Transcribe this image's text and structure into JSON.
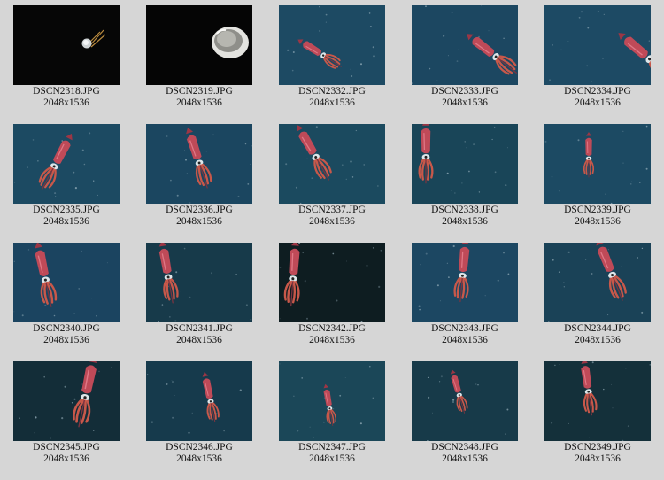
{
  "thumbnails": [
    {
      "filename": "DSCN2318.JPG",
      "dims": "2048x1536",
      "bg": "#060606",
      "subject": "probe"
    },
    {
      "filename": "DSCN2319.JPG",
      "dims": "2048x1536",
      "bg": "#050505",
      "subject": "jelly"
    },
    {
      "filename": "DSCN2332.JPG",
      "dims": "2048x1536",
      "bg": "#1d4a63",
      "subject": "squid"
    },
    {
      "filename": "DSCN2333.JPG",
      "dims": "2048x1536",
      "bg": "#1c4761",
      "subject": "squid"
    },
    {
      "filename": "DSCN2334.JPG",
      "dims": "2048x1536",
      "bg": "#1d4a64",
      "subject": "squid"
    },
    {
      "filename": "DSCN2335.JPG",
      "dims": "2048x1536",
      "bg": "#1c4a62",
      "subject": "squid"
    },
    {
      "filename": "DSCN2336.JPG",
      "dims": "2048x1536",
      "bg": "#1b4660",
      "subject": "squid"
    },
    {
      "filename": "DSCN2337.JPG",
      "dims": "2048x1536",
      "bg": "#1b4a5f",
      "subject": "squid"
    },
    {
      "filename": "DSCN2338.JPG",
      "dims": "2048x1536",
      "bg": "#194558",
      "subject": "squid"
    },
    {
      "filename": "DSCN2339.JPG",
      "dims": "2048x1536",
      "bg": "#1c4a63",
      "subject": "squid"
    },
    {
      "filename": "DSCN2340.JPG",
      "dims": "2048x1536",
      "bg": "#1b4460",
      "subject": "squid"
    },
    {
      "filename": "DSCN2341.JPG",
      "dims": "2048x1536",
      "bg": "#173a4a",
      "subject": "squid"
    },
    {
      "filename": "DSCN2342.JPG",
      "dims": "2048x1536",
      "bg": "#0e1d21",
      "subject": "squid"
    },
    {
      "filename": "DSCN2343.JPG",
      "dims": "2048x1536",
      "bg": "#1c4762",
      "subject": "squid"
    },
    {
      "filename": "DSCN2344.JPG",
      "dims": "2048x1536",
      "bg": "#1a4257",
      "subject": "squid"
    },
    {
      "filename": "DSCN2345.JPG",
      "dims": "2048x1536",
      "bg": "#132d38",
      "subject": "squid"
    },
    {
      "filename": "DSCN2346.JPG",
      "dims": "2048x1536",
      "bg": "#163a4c",
      "subject": "squid"
    },
    {
      "filename": "DSCN2347.JPG",
      "dims": "2048x1536",
      "bg": "#1b4758",
      "subject": "squid"
    },
    {
      "filename": "DSCN2348.JPG",
      "dims": "2048x1536",
      "bg": "#173a49",
      "subject": "squid"
    },
    {
      "filename": "DSCN2349.JPG",
      "dims": "2048x1536",
      "bg": "#14303a",
      "subject": "squid"
    }
  ]
}
